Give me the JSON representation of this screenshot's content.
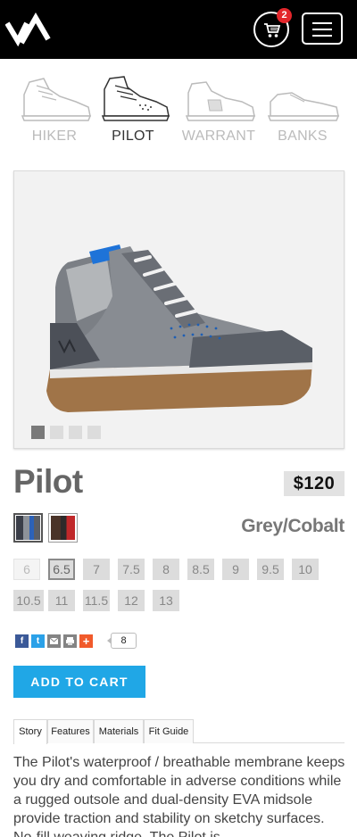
{
  "header": {
    "cart_count": "2",
    "colors": {
      "bar": "#000000",
      "badge": "#e3262b"
    }
  },
  "models": [
    {
      "label": "HIKER",
      "active": false
    },
    {
      "label": "PILOT",
      "active": true
    },
    {
      "label": "WARRANT",
      "active": false
    },
    {
      "label": "BANKS",
      "active": false
    }
  ],
  "gallery": {
    "slide_count": 4,
    "active_slide": 1
  },
  "product": {
    "name": "Pilot",
    "price": "$120",
    "color_name": "Grey/Cobalt",
    "swatches": [
      {
        "name": "Grey/Cobalt",
        "selected": true
      },
      {
        "name": "Brown/Red",
        "selected": false
      }
    ]
  },
  "sizes": [
    {
      "label": "6",
      "state": "disabled"
    },
    {
      "label": "6.5",
      "state": "selected"
    },
    {
      "label": "7",
      "state": "available"
    },
    {
      "label": "7.5",
      "state": "available"
    },
    {
      "label": "8",
      "state": "available"
    },
    {
      "label": "8.5",
      "state": "available"
    },
    {
      "label": "9",
      "state": "available"
    },
    {
      "label": "9.5",
      "state": "available"
    },
    {
      "label": "10",
      "state": "available"
    },
    {
      "label": "10.5",
      "state": "available"
    },
    {
      "label": "11",
      "state": "available"
    },
    {
      "label": "11.5",
      "state": "available"
    },
    {
      "label": "12",
      "state": "available"
    },
    {
      "label": "13",
      "state": "available"
    }
  ],
  "share": {
    "count": "8",
    "icons": [
      "facebook-icon",
      "twitter-icon",
      "email-icon",
      "print-icon",
      "addthis-icon"
    ]
  },
  "cart_button": "ADD TO CART",
  "tabs": [
    {
      "label": "Story",
      "active": true
    },
    {
      "label": "Features",
      "active": false
    },
    {
      "label": "Materials",
      "active": false
    },
    {
      "label": "Fit Guide",
      "active": false
    }
  ],
  "description": "The Pilot's waterproof / breathable membrane keeps you dry and comfortable in adverse conditions while a rugged outsole and dual-density EVA midsole provide traction and stability on sketchy surfaces. No-fill weaving ridge. The Pilot is",
  "theme": {
    "accent": "#20a7e6",
    "price_bg": "#e2e2e2"
  }
}
